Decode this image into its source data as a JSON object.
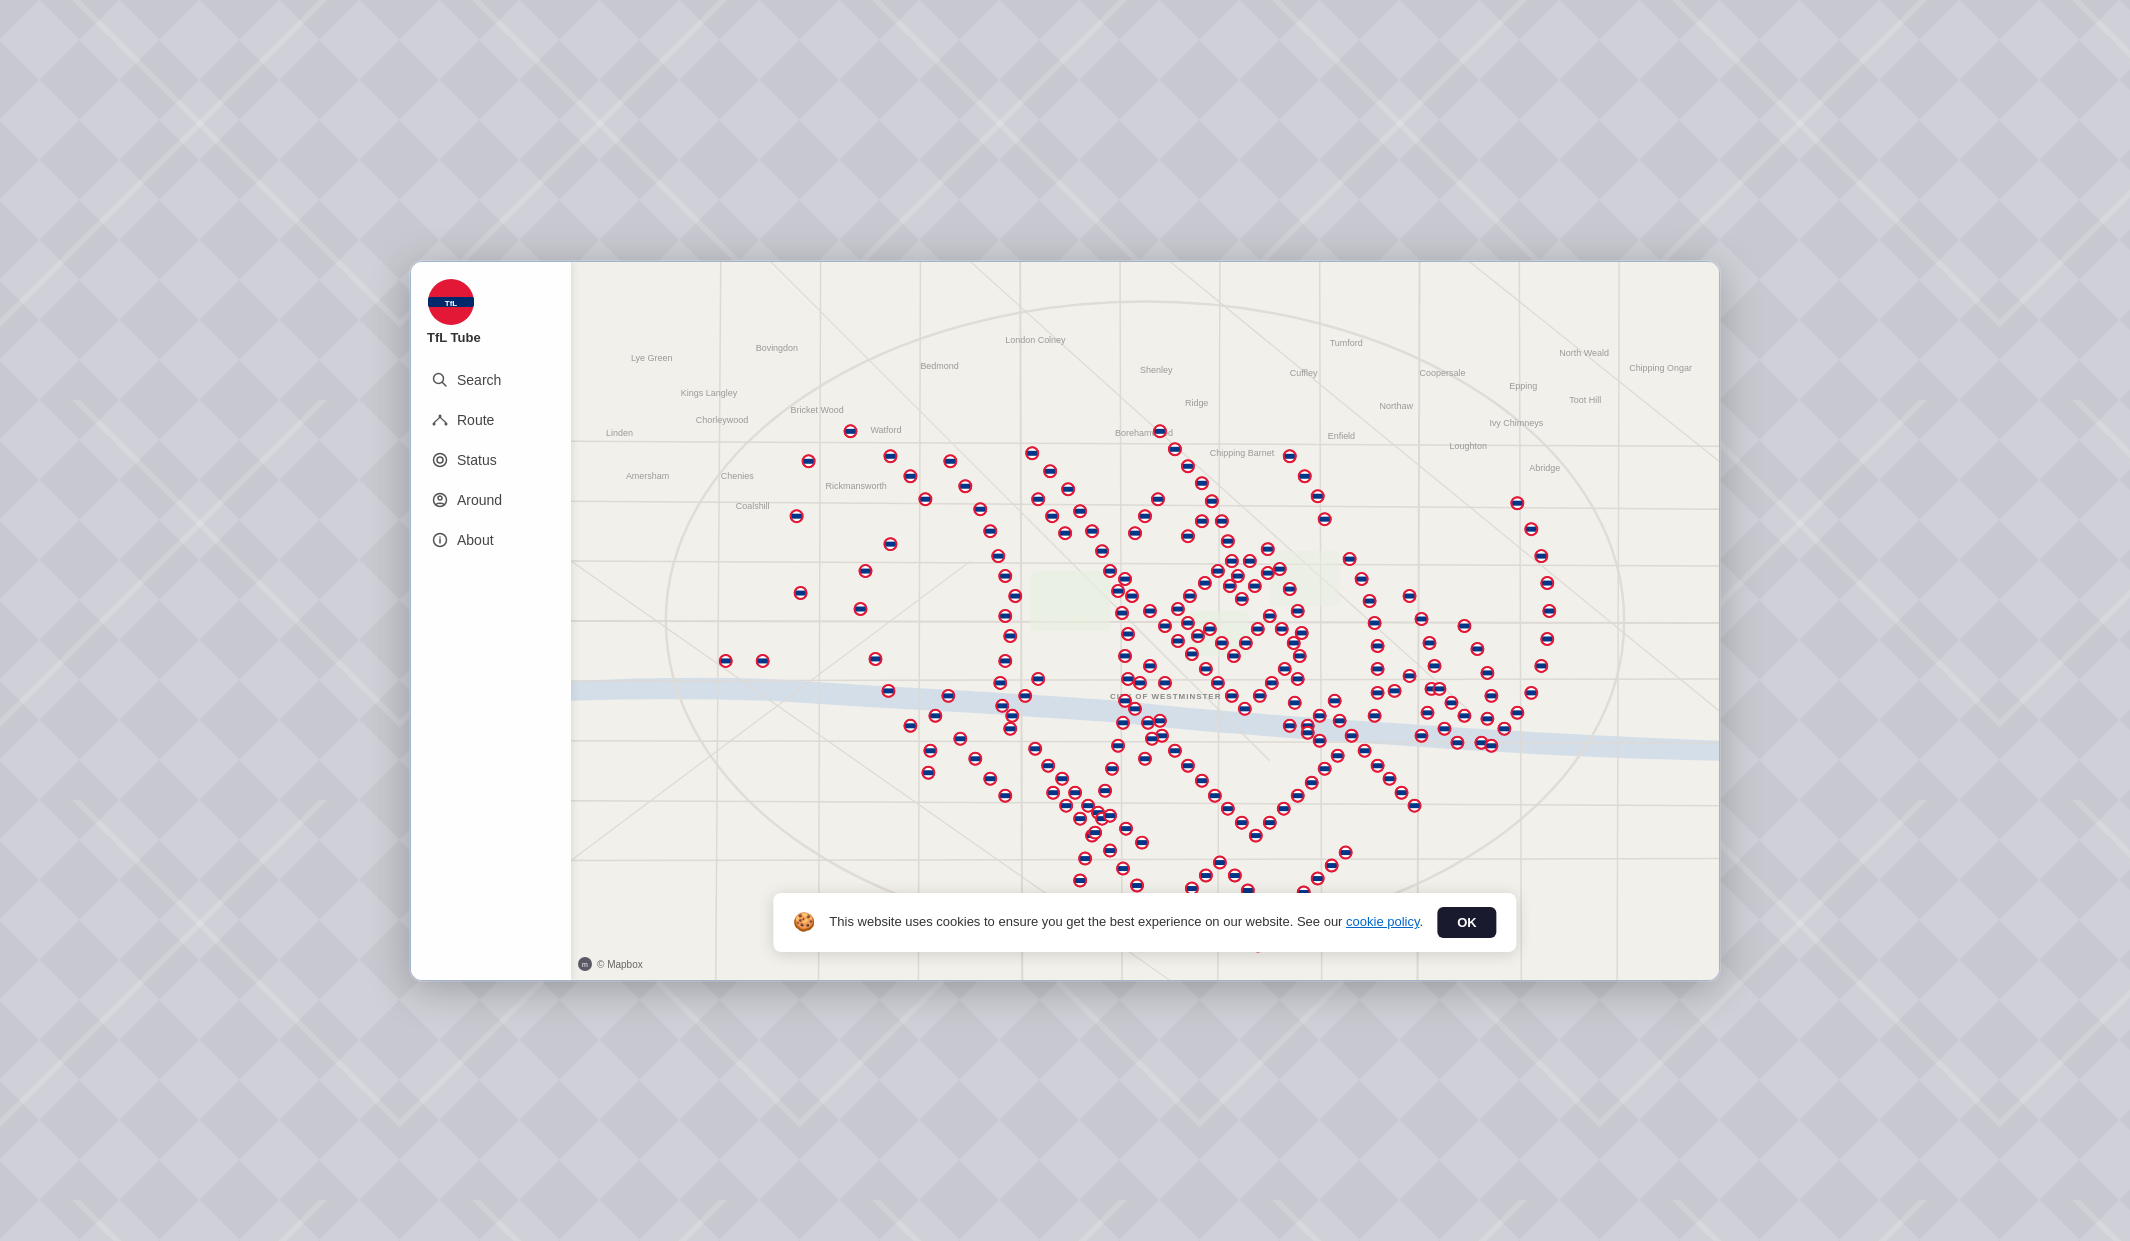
{
  "app": {
    "title": "TfL Tube",
    "logo_alt": "TfL roundel"
  },
  "sidebar": {
    "items": [
      {
        "id": "search",
        "label": "Search",
        "icon": "search"
      },
      {
        "id": "route",
        "label": "Route",
        "icon": "route"
      },
      {
        "id": "status",
        "label": "Status",
        "icon": "status"
      },
      {
        "id": "around",
        "label": "Around",
        "icon": "location"
      },
      {
        "id": "about",
        "label": "About",
        "icon": "info"
      }
    ]
  },
  "map": {
    "attribution": "© Mapbox",
    "center_label": "CITY OF WESTMINSTER"
  },
  "cookie": {
    "message": "This website uses cookies to ensure you get the best experience on our website. See our ",
    "link_text": "cookie policy",
    "ok_label": "OK"
  },
  "icons": {
    "search": "⌕",
    "route": "⇌",
    "status": "◎",
    "location": "◎",
    "info": "ℹ",
    "cookie": "🍪",
    "mapbox": "© Mapbox"
  }
}
